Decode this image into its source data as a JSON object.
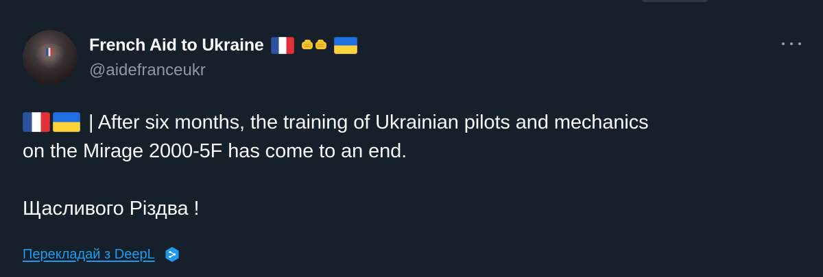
{
  "author": {
    "display_name": "French Aid to Ukraine",
    "handle": "@aidefranceukr",
    "name_emojis": [
      "flag-france",
      "fist-bump",
      "flag-ukraine"
    ]
  },
  "tweet": {
    "line1_prefix_emojis": [
      "flag-france",
      "flag-ukraine"
    ],
    "line1_text": "| After six months, the training of Ukrainian pilots and mechanics",
    "line2_text": "on the Mirage 2000-5F has come to an end.",
    "line3_text": "Щасливого Різдва !"
  },
  "translate": {
    "link_label": "Перекладай з DeepL",
    "icon": "deepl-icon"
  },
  "menu": {
    "icon": "more-options-icon"
  },
  "colors": {
    "background": "#15202b",
    "primary_text": "#f7f9f9",
    "secondary_text": "#8b98a5",
    "link": "#1d9bf0"
  }
}
